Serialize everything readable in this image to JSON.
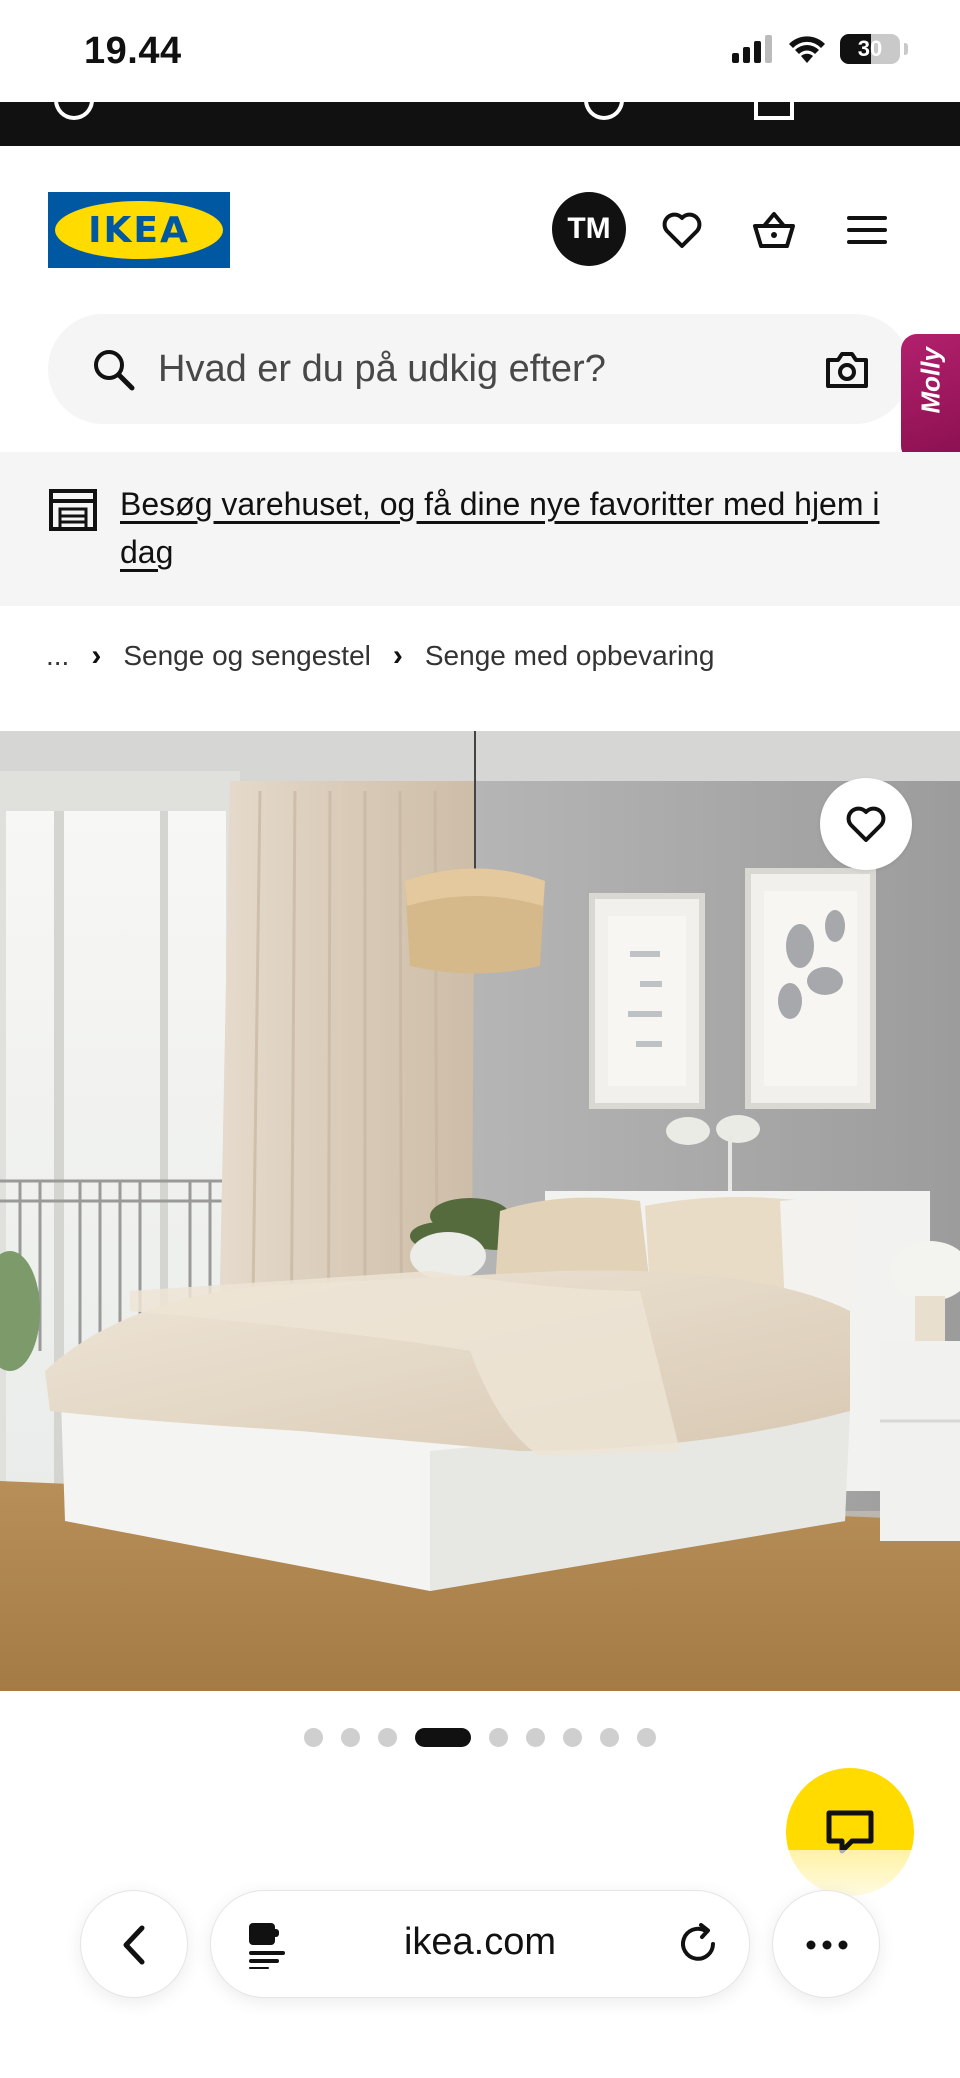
{
  "status_bar": {
    "time": "19.44",
    "battery": "30"
  },
  "header": {
    "logo_text": "IKEA",
    "avatar_initials": "TM"
  },
  "search": {
    "placeholder": "Hvad er du på udkig efter?"
  },
  "molly": {
    "label": "Molly"
  },
  "banner": {
    "text": "Besøg varehuset, og få dine nye favoritter med hjem i dag"
  },
  "breadcrumb": {
    "ellipsis": "...",
    "items": [
      "Senge og sengestel",
      "Senge med opbevaring"
    ]
  },
  "gallery": {
    "total_images": 9,
    "active_index": 3
  },
  "browser": {
    "url": "ikea.com"
  },
  "colors": {
    "ikea_blue": "#0058a3",
    "ikea_yellow": "#ffdb00",
    "molly_magenta": "#b3206d"
  }
}
